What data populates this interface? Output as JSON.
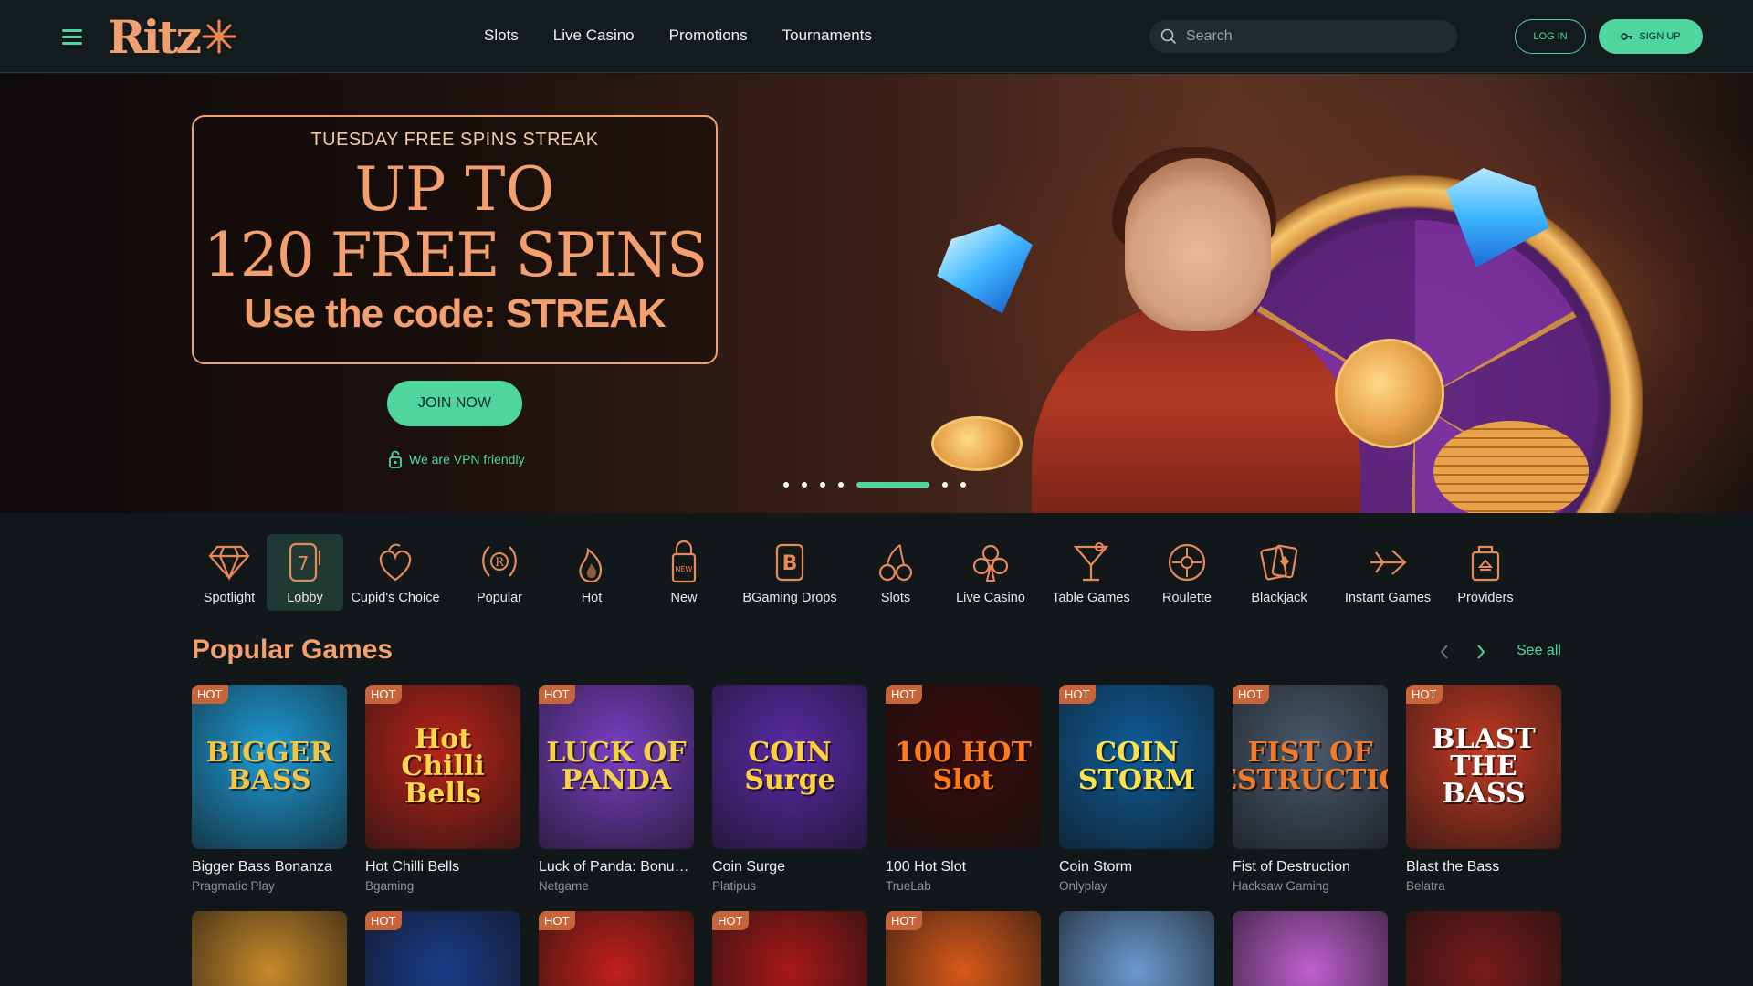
{
  "brand": {
    "logo_text": "Ritz",
    "accent": "#4fd6a0",
    "orange": "#f3a06e"
  },
  "nav": [
    "Slots",
    "Live Casino",
    "Promotions",
    "Tournaments"
  ],
  "search": {
    "placeholder": "Search"
  },
  "auth": {
    "login": "LOG IN",
    "signup": "SIGN UP"
  },
  "hero": {
    "subtitle": "TUESDAY FREE SPINS STREAK",
    "line1": "UP TO",
    "line2": "120 FREE SPINS",
    "code": "Use the code: STREAK",
    "cta": "JOIN NOW",
    "vpn": "We are VPN friendly",
    "slides_total": 7,
    "active_slide": 5
  },
  "categories": [
    {
      "label": "Spotlight",
      "icon": "diamond-icon"
    },
    {
      "label": "Lobby",
      "icon": "slot-machine-icon",
      "active": true
    },
    {
      "label": "Cupid's Choice",
      "icon": "heart-icon"
    },
    {
      "label": "Popular",
      "icon": "laurel-icon"
    },
    {
      "label": "Hot",
      "icon": "flame-icon"
    },
    {
      "label": "New",
      "icon": "new-tag-icon"
    },
    {
      "label": "BGaming Drops",
      "icon": "b-badge-icon"
    },
    {
      "label": "Slots",
      "icon": "cherry-icon"
    },
    {
      "label": "Live Casino",
      "icon": "club-icon"
    },
    {
      "label": "Table Games",
      "icon": "cocktail-icon"
    },
    {
      "label": "Roulette",
      "icon": "roulette-icon"
    },
    {
      "label": "Blackjack",
      "icon": "cards-icon"
    },
    {
      "label": "Instant Games",
      "icon": "plane-icon"
    },
    {
      "label": "Providers",
      "icon": "bag-icon"
    }
  ],
  "popular": {
    "title": "Popular Games",
    "see_all": "See all",
    "hot_label": "HOT",
    "games": [
      {
        "name": "Bigger Bass Bonanza",
        "provider": "Pragmatic Play",
        "hot": true,
        "art": "BIGGER BASS",
        "bg": "#1e9bd6",
        "fg": "#f5c542"
      },
      {
        "name": "Hot Chilli Bells",
        "provider": "Bgaming",
        "hot": true,
        "art": "Hot Chilli Bells",
        "bg": "#b8231a",
        "fg": "#ffd84a"
      },
      {
        "name": "Luck of Panda: Bonus ...",
        "provider": "Netgame",
        "hot": true,
        "art": "LUCK OF PANDA",
        "bg": "#7a3fc4",
        "fg": "#f5d24a"
      },
      {
        "name": "Coin Surge",
        "provider": "Platipus",
        "hot": false,
        "art": "COIN Surge",
        "bg": "#5a2aa8",
        "fg": "#ffd23a"
      },
      {
        "name": "100 Hot Slot",
        "provider": "TrueLab",
        "hot": true,
        "art": "100 HOT Slot",
        "bg": "#3a0c0c",
        "fg": "#ff7a1a"
      },
      {
        "name": "Coin Storm",
        "provider": "Onlyplay",
        "hot": true,
        "art": "COIN STORM",
        "bg": "#0e5d9a",
        "fg": "#ffe14a"
      },
      {
        "name": "Fist of Destruction",
        "provider": "Hacksaw Gaming",
        "hot": true,
        "art": "FIST OF DESTRUCTION",
        "bg": "#4a5a6e",
        "fg": "#f07a2a"
      },
      {
        "name": "Blast the Bass",
        "provider": "Belatra",
        "hot": true,
        "art": "BLAST THE BASS",
        "bg": "#c23a22",
        "fg": "#ffffff"
      }
    ],
    "row2": [
      {
        "hot": false,
        "bg": "#c88a2a"
      },
      {
        "hot": true,
        "bg": "#1a3c8a"
      },
      {
        "hot": true,
        "bg": "#c2201a"
      },
      {
        "hot": true,
        "bg": "#a81818"
      },
      {
        "hot": true,
        "bg": "#d85a1a"
      },
      {
        "hot": false,
        "bg": "#6a9ad0"
      },
      {
        "hot": false,
        "bg": "#c060d0"
      },
      {
        "hot": false,
        "bg": "#7a1a1a"
      }
    ]
  }
}
